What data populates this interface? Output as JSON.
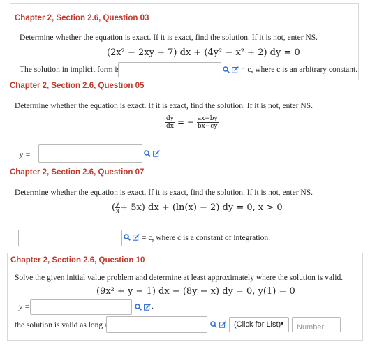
{
  "q03": {
    "heading": "Chapter 2, Section 2.6, Question 03",
    "prompt": "Determine whether the equation is exact. If it is exact, find the solution. If it is not, enter NS.",
    "equation": "(2x² − 2xy + 7) dx + (4y² − x² + 2) dy = 0",
    "answer_label": "The solution in implicit form is",
    "suffix": "= c,  where c is an arbitrary constant."
  },
  "q05": {
    "heading": "Chapter 2, Section 2.6, Question 05",
    "prompt": "Determine whether the equation is exact. If it is exact, find the solution. If it is not, enter NS.",
    "lhs_num": "dy",
    "lhs_den": "dx",
    "rhs_num": "ax−by",
    "rhs_den": "bx−cy",
    "answer_label": "y ="
  },
  "q07": {
    "heading": "Chapter 2, Section 2.6, Question 07",
    "prompt": "Determine whether the equation is exact. If it is exact, find the solution. If it is not, enter NS.",
    "equation_rest": "+ 5x) dx + (ln(x) − 2) dy = 0,  x > 0",
    "frac_num": "y",
    "frac_den": "x",
    "suffix": "= c, where c is a constant of integration."
  },
  "q10": {
    "heading": "Chapter 2, Section 2.6, Question 10",
    "prompt": "Solve the given initial value problem and determine at least approximately where the solution is valid.",
    "equation": "(9x² + y − 1) dx − (8y − x) dy = 0,  y(1) = 0",
    "answer_label": "y =",
    "after_icons": ".",
    "valid_label": "the solution is valid as long as",
    "select_value": "(Click for List)",
    "number_placeholder": "Number"
  },
  "colors": {
    "heading": "#c0392b",
    "icon": "#2f6fd6"
  },
  "icons": [
    "search-icon",
    "edit-icon",
    "chevron-down-icon"
  ]
}
